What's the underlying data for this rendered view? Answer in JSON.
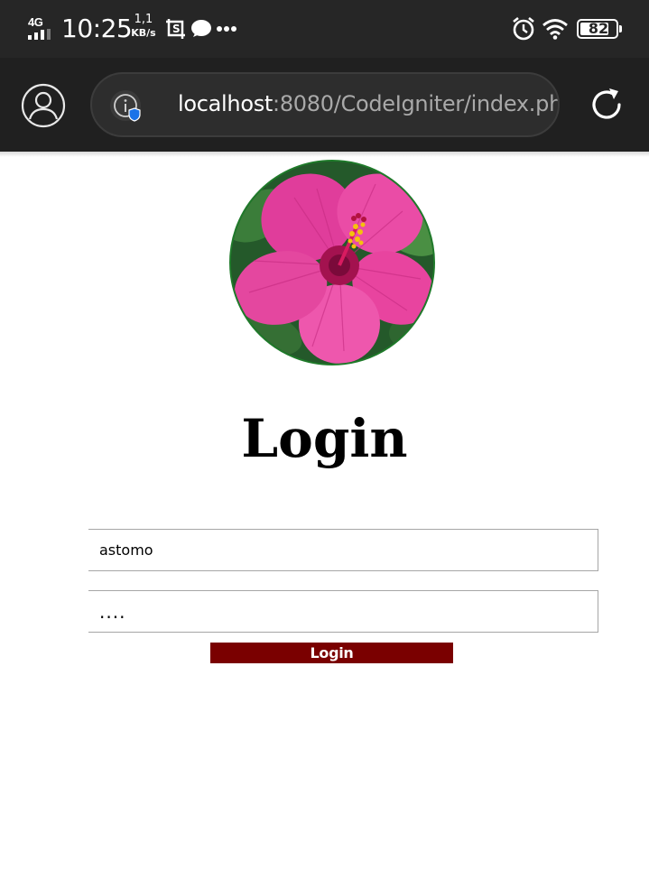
{
  "status_bar": {
    "network": "4G",
    "time": "10:25",
    "speed_value": "1,1",
    "speed_unit": "KB/s",
    "battery": "82",
    "battery_level": 0.82,
    "icons": [
      "screenshot-icon",
      "message-bubble-icon",
      "more-dots-icon",
      "alarm-icon",
      "wifi-icon",
      "battery-icon"
    ]
  },
  "browser": {
    "url_host": "localhost",
    "url_rest": ":8080/CodeIgniter/index.ph",
    "icons": [
      "profile-icon",
      "site-info-icon",
      "shield-icon",
      "reload-icon"
    ]
  },
  "page": {
    "title": "Login",
    "username_value": "astomo",
    "password_value": "....",
    "login_button": "Login"
  },
  "colors": {
    "status_bar_bg": "#262626",
    "browser_bar_bg": "#202020",
    "button_bg": "#7a0000",
    "avatar_border": "#1f7a2a",
    "flower_pink": "#e83a9a"
  }
}
